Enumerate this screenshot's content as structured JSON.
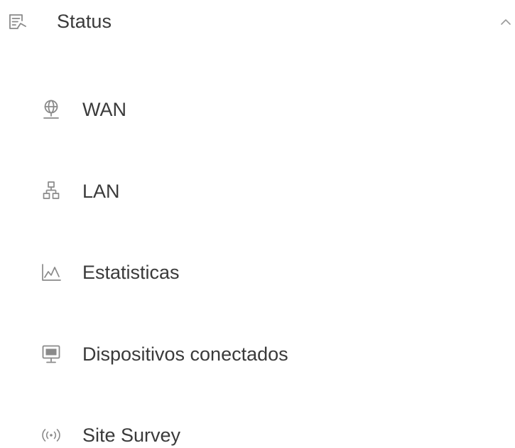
{
  "menu": {
    "title": "Status",
    "icon": "status-list-icon",
    "expanded": true,
    "items": [
      {
        "label": "WAN",
        "icon": "globe-icon"
      },
      {
        "label": "LAN",
        "icon": "network-icon"
      },
      {
        "label": "Estatisticas",
        "icon": "line-chart-icon"
      },
      {
        "label": "Dispositivos conectados",
        "icon": "monitor-icon"
      },
      {
        "label": "Site Survey",
        "icon": "wireless-signal-icon"
      }
    ]
  },
  "colors": {
    "text": "#3a3a3a",
    "icon": "#8a8a8a",
    "background": "#ffffff"
  }
}
